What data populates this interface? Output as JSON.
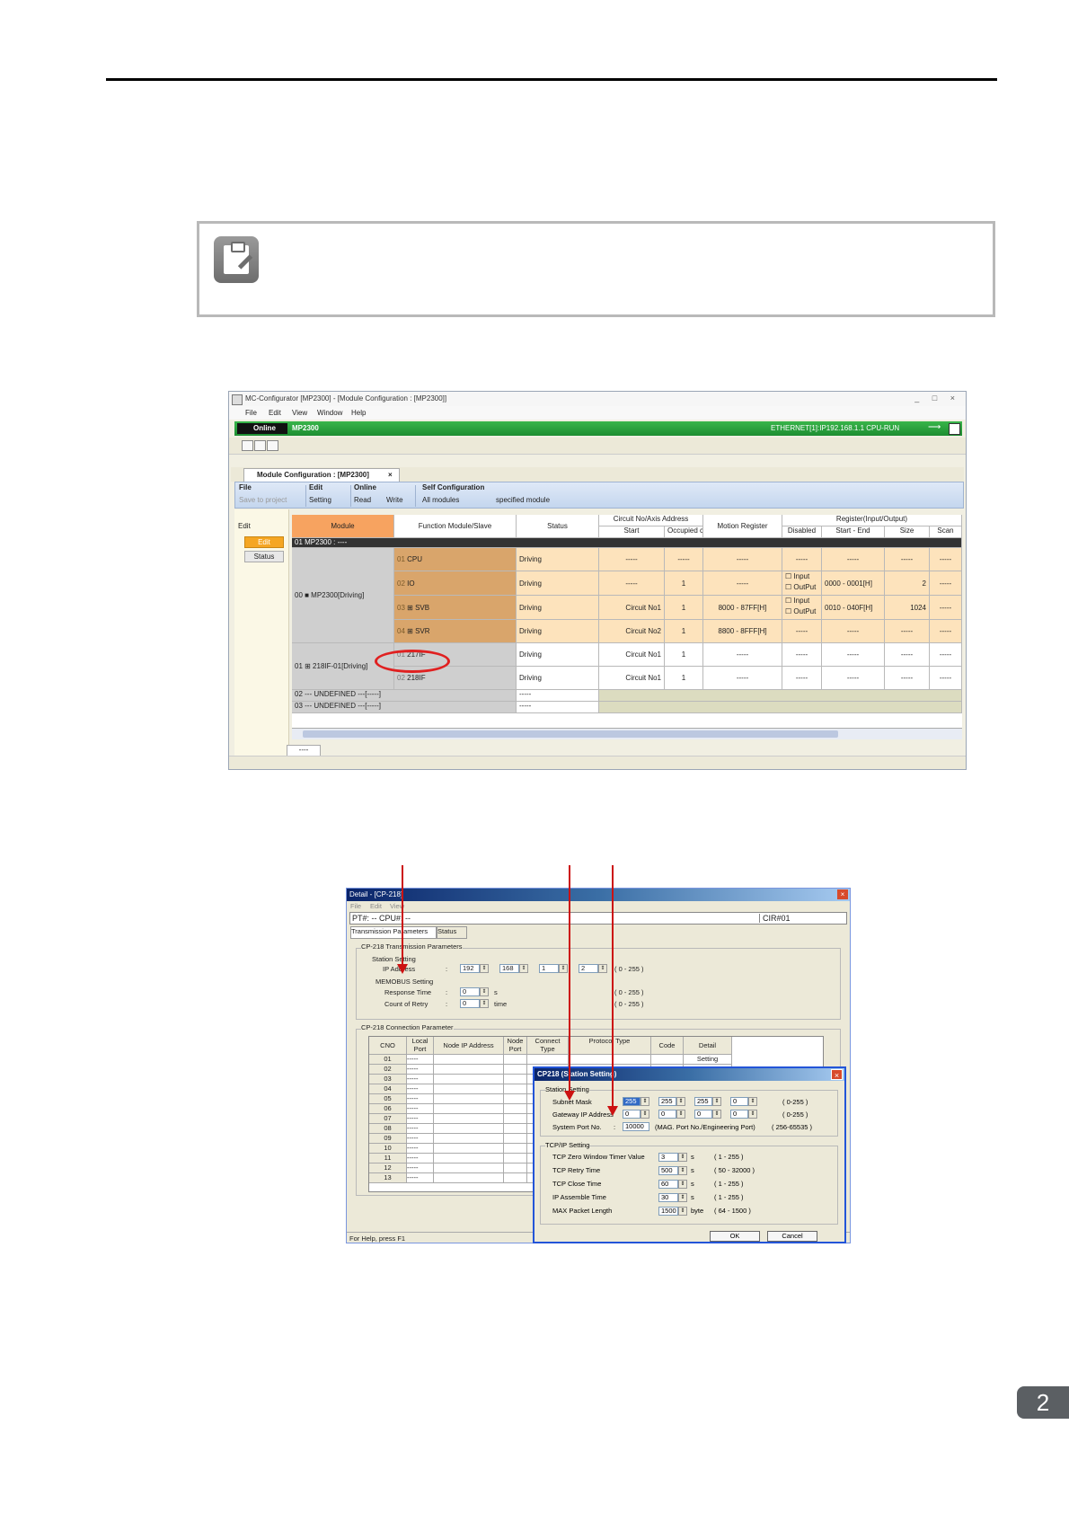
{
  "main_window": {
    "title": "MC-Configurator [MP2300] - [Module Configuration : [MP2300]]",
    "window_buttons": "_ □ ×",
    "menu": [
      "File",
      "Edit",
      "View",
      "Window",
      "Help"
    ],
    "online_label": "Online",
    "device": "MP2300",
    "connection": "ETHERNET[1]:IP192.168.1.1 CPU-RUN",
    "tab": "Module Configuration : [MP2300]",
    "ribbon": {
      "file": "File",
      "save": "Save to project",
      "edit": "Edit",
      "setting": "Setting",
      "online": "Online",
      "read": "Read",
      "write": "Write",
      "self_config": "Self Configuration",
      "all_modules": "All modules",
      "specified_module": "specified module"
    },
    "left": {
      "label": "Edit",
      "edit_btn": "Edit",
      "status_btn": "Status"
    },
    "headers": {
      "module": "Module",
      "function": "Function Module/Slave",
      "status": "Status",
      "circuit": "Circuit No/Axis Address",
      "start": "Start",
      "occupied": "Occupied circuits",
      "motion": "Motion Register",
      "register": "Register(Input/Output)",
      "disabled": "Disabled",
      "startend": "Start - End",
      "size": "Size",
      "scan": "Scan"
    },
    "group_row": "01 MP2300 : ----",
    "mod1": "00 ■ MP2300[Driving]",
    "mod2": "01 ⊞ 218IF-01[Driving]",
    "rows": [
      {
        "no": "01",
        "fn": "CPU",
        "status": "Driving",
        "start": "-----",
        "occ": "-----",
        "motion": "-----",
        "dis": "-----",
        "se": "-----",
        "size": "-----",
        "scan": "-----"
      },
      {
        "no": "02",
        "fn": "IO",
        "status": "Driving",
        "start": "-----",
        "occ": "1",
        "motion": "-----",
        "dis1": "Input",
        "dis2": "OutPut",
        "se": "0000 - 0001[H]",
        "size": "2",
        "scan": "-----"
      },
      {
        "no": "03",
        "fn": "SVB",
        "status": "Driving",
        "start": "Circuit No1",
        "occ": "1",
        "motion": "8000 - 87FF[H]",
        "dis1": "Input",
        "dis2": "OutPut",
        "se": "0010 - 040F[H]",
        "size": "1024",
        "scan": "-----"
      },
      {
        "no": "04",
        "fn": "SVR",
        "status": "Driving",
        "start": "Circuit No2",
        "occ": "1",
        "motion": "8800 - 8FFF[H]",
        "dis": "-----",
        "se": "-----",
        "size": "-----",
        "scan": "-----"
      },
      {
        "no": "01",
        "fn": "217IF",
        "status": "Driving",
        "start": "Circuit No1",
        "occ": "1",
        "motion": "-----",
        "dis": "-----",
        "se": "-----",
        "size": "-----",
        "scan": "-----"
      },
      {
        "no": "02",
        "fn": "218IF",
        "status": "Driving",
        "start": "Circuit No1",
        "occ": "1",
        "motion": "-----",
        "dis": "-----",
        "se": "-----",
        "size": "-----",
        "scan": "-----"
      }
    ],
    "undef1": "02 --- UNDEFINED ---[-----]",
    "undef2": "03 --- UNDEFINED ---[-----]",
    "undef_status": "-----",
    "bottom_tab": "----"
  },
  "detail_dialog": {
    "title": "Detail - [CP-218]",
    "menu": [
      "File",
      "Edit",
      "View"
    ],
    "pt_cpu": "PT#: -- CPU#: --",
    "cir": "CIR#01",
    "tabs": [
      "Transmission Parameters",
      "Status"
    ],
    "trans_group": "CP-218 Transmission Parameters",
    "station_setting": "Station Setting",
    "ip_label": "IP Address",
    "ip": [
      "192",
      "168",
      "1",
      "2"
    ],
    "ip_range": "( 0 - 255 )",
    "memobus": "MEMOBUS Setting",
    "response_label": "Response Time",
    "response_val": "0",
    "response_unit": "s",
    "response_range": "( 0 - 255 )",
    "retry_label": "Count of Retry",
    "retry_val": "0",
    "retry_unit": "time",
    "retry_range": "( 0 - 255 )",
    "conn_group": "CP-218 Connection Parameter",
    "cols": [
      "CNO",
      "Local Port",
      "Node IP Address",
      "Node Port",
      "Connect Type",
      "Protocol Type",
      "Code",
      "Detail"
    ],
    "cnos": [
      "01",
      "02",
      "03",
      "04",
      "05",
      "06",
      "07",
      "08",
      "09",
      "10",
      "11",
      "12",
      "13"
    ],
    "dash": "-----",
    "setting_btn": "Setting",
    "status_text": "For Help, press F1"
  },
  "station_dialog": {
    "title": "CP218 (Station Setting)",
    "group1": "Station Setting",
    "subnet_label": "Subnet Mask",
    "subnet": [
      "255",
      "255",
      "255",
      "0"
    ],
    "subnet_range": "( 0-255 )",
    "gateway_label": "Gateway IP Address",
    "gateway": [
      "0",
      "0",
      "0",
      "0"
    ],
    "gateway_range": "( 0-255 )",
    "sysport_label": "System Port No.",
    "sysport_val": "10000",
    "sysport_note": "(MAG. Port No./Engineering Port)",
    "sysport_range": "( 256-65535 )",
    "group2": "TCP/IP Setting",
    "tcp": [
      {
        "label": "TCP Zero Window Timer Value",
        "val": "3",
        "unit": "s",
        "range": "( 1 - 255 )"
      },
      {
        "label": "TCP Retry Time",
        "val": "500",
        "unit": "s",
        "range": "( 50 - 32000 )"
      },
      {
        "label": "TCP Close Time",
        "val": "60",
        "unit": "s",
        "range": "( 1 - 255 )"
      },
      {
        "label": "IP Assemble Time",
        "val": "30",
        "unit": "s",
        "range": "( 1 - 255 )"
      },
      {
        "label": "MAX Packet Length",
        "val": "1500",
        "unit": "byte",
        "range": "( 64 - 1500 )"
      }
    ],
    "ok": "OK",
    "cancel": "Cancel"
  },
  "page_number": "2"
}
